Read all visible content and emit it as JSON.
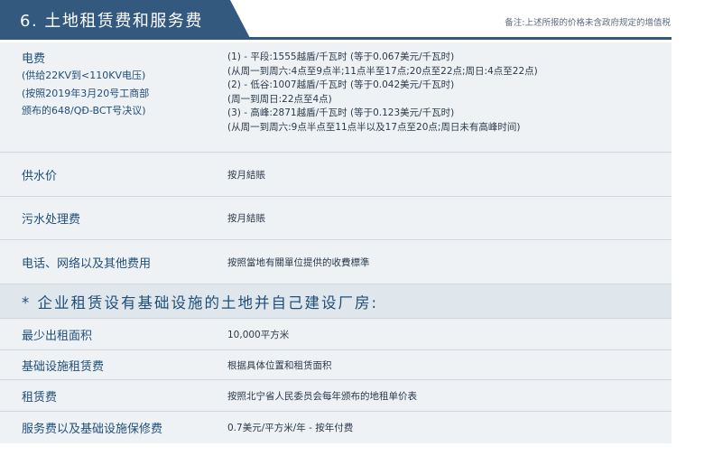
{
  "header": {
    "title": "6. 土地租赁费和服务费",
    "note": "备注:上述所报的价格未含政府规定的增值税"
  },
  "utilities": {
    "electricity": {
      "label": "电费",
      "sub_lines": [
        "(供给22KV到<110KV电压)",
        "(按照2019年3月20号工商部",
        "颁布的648/QĐ-BCT号决议)"
      ],
      "value_lines": [
        "(1) - 平段:1555越盾/千瓦时 (等于0.067美元/千瓦时)",
        "(从周一到周六:4点至9点半;11点半至17点;20点至22点;周日:4点至22点)",
        "(2) - 低谷:1007越盾/千瓦时 (等于0.042美元/千瓦时)",
        "(周一到周日:22点至4点)",
        "(3) - 高峰:2871越盾/千瓦时 (等于0.123美元/千瓦时)",
        "(从周一到周六:9点半点至11点半以及17点至20点;周日未有高峰时间)"
      ]
    },
    "rows": [
      {
        "label": "供水价",
        "value": "按月結賬"
      },
      {
        "label": "污水处理费",
        "value": "按月結賬"
      },
      {
        "label": "电话、网络以及其他费用",
        "value": "按照當地有關單位提供的收費標準"
      }
    ]
  },
  "section": {
    "title": "* 企业租赁设有基础设施的土地并自己建设厂房:"
  },
  "land_rows": [
    {
      "label": "最少出租面积",
      "value": "10,000平方米"
    },
    {
      "label": "基础设施租赁费",
      "value": "根据具体位置和租赁面积"
    },
    {
      "label": "租赁费",
      "value": "按照北宁省人民委员会每年颁布的地租单价表"
    },
    {
      "label": "服务费以及基础设施保修费",
      "value": "0.7美元/平方米/年 - 按年付费"
    }
  ]
}
